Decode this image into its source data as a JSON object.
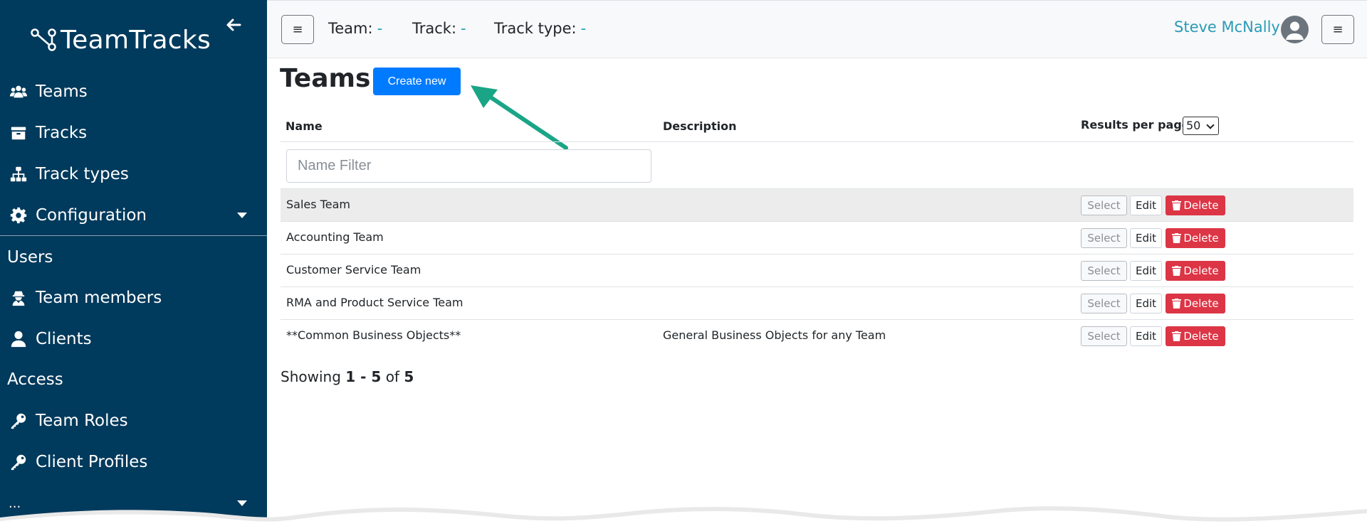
{
  "app": {
    "name": "TeamTracks"
  },
  "sidebar": {
    "items": [
      {
        "label": "Teams",
        "icon": "users-icon"
      },
      {
        "label": "Tracks",
        "icon": "archive-icon"
      },
      {
        "label": "Track types",
        "icon": "sitemap-icon"
      },
      {
        "label": "Configuration",
        "icon": "gear-icon"
      }
    ],
    "sections": [
      {
        "label": "Users"
      },
      {
        "label": "Access"
      }
    ],
    "user_items": [
      {
        "label": "Team members",
        "icon": "user-secret-icon"
      },
      {
        "label": "Clients",
        "icon": "user-icon"
      }
    ],
    "access_items": [
      {
        "label": "Team Roles",
        "icon": "key-icon"
      },
      {
        "label": "Client Profiles",
        "icon": "key-icon"
      }
    ],
    "more_label": "..."
  },
  "topbar": {
    "team_label": "Team:",
    "team_value": "-",
    "track_label": "Track:",
    "track_value": "-",
    "track_type_label": "Track type:",
    "track_type_value": "-",
    "user_name": "Steve McNally"
  },
  "main": {
    "title": "Teams",
    "create_label": "Create new",
    "columns": {
      "name": "Name",
      "description": "Description"
    },
    "results_per_page_label": "Results per page",
    "results_per_page_value": "50",
    "name_filter_placeholder": "Name Filter",
    "row_actions": {
      "select": "Select",
      "edit": "Edit",
      "delete": "Delete"
    },
    "rows": [
      {
        "name": "Sales Team",
        "description": ""
      },
      {
        "name": "Accounting Team",
        "description": ""
      },
      {
        "name": "Customer Service Team",
        "description": ""
      },
      {
        "name": "RMA and Product Service Team",
        "description": ""
      },
      {
        "name": "**Common Business Objects**",
        "description": "General Business Objects for any Team"
      }
    ],
    "showing": {
      "prefix": "Showing",
      "range": "1 - 5",
      "of": "of",
      "total": "5"
    }
  },
  "colors": {
    "sidebar_bg": "#003a5c",
    "primary": "#007bff",
    "danger": "#dc3545",
    "accent": "#2a9bb6",
    "annotation_arrow": "#1aa587"
  }
}
